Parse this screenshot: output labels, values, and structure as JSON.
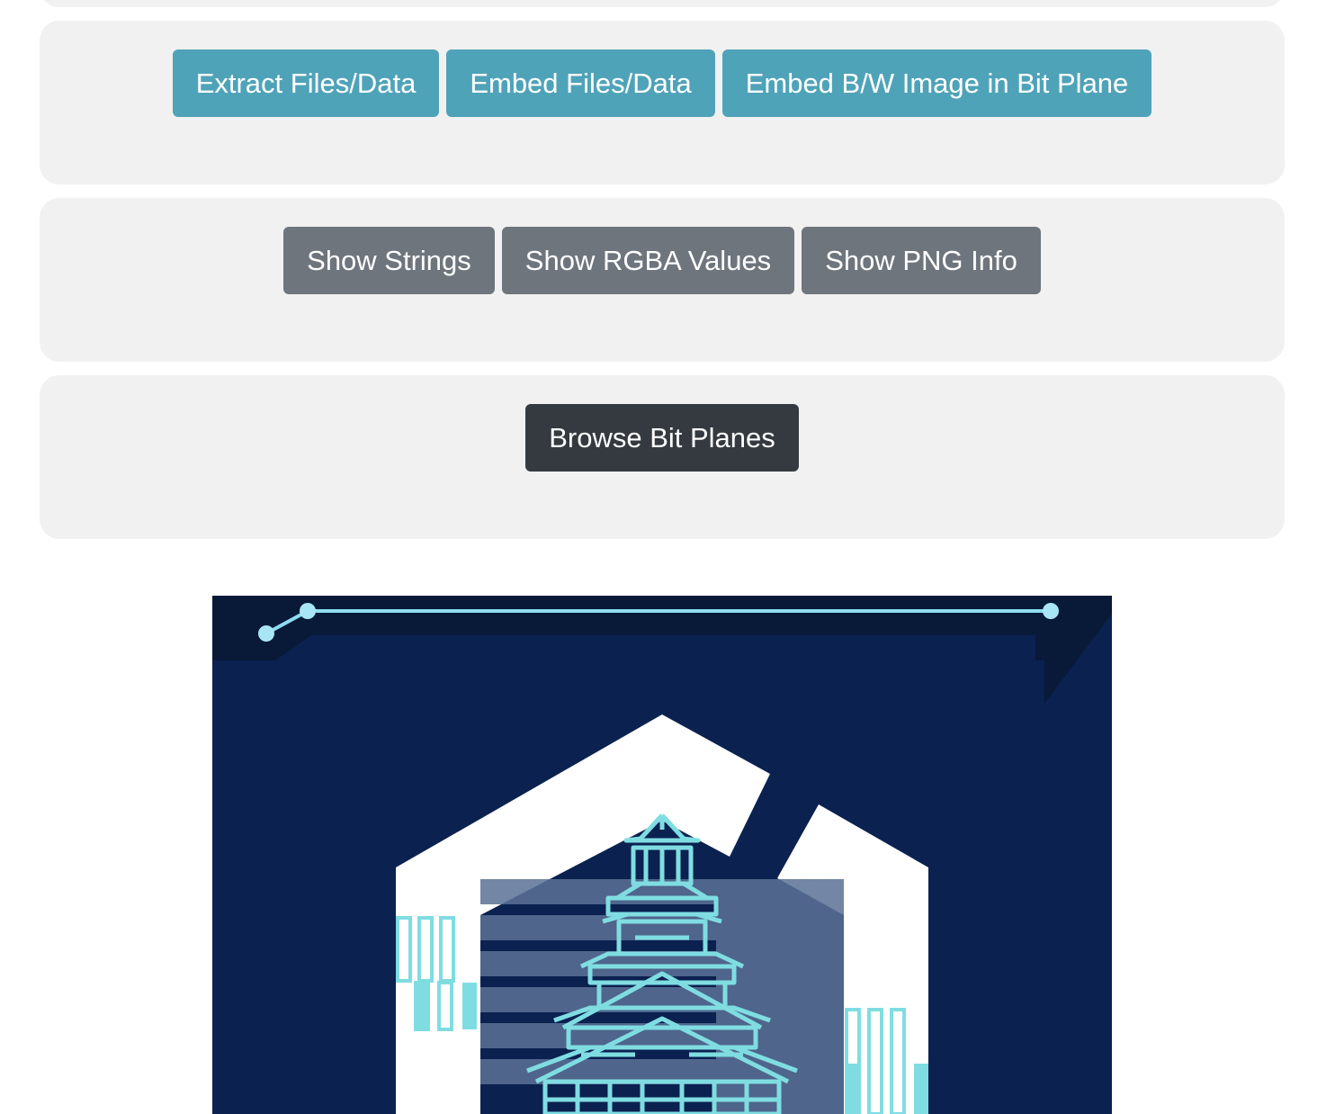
{
  "panels": {
    "embed_extract": {
      "extract_label": "Extract Files/Data",
      "embed_label": "Embed Files/Data",
      "embed_bw_label": "Embed B/W Image in Bit Plane"
    },
    "inspect": {
      "strings_label": "Show Strings",
      "rgba_label": "Show RGBA Values",
      "png_info_label": "Show PNG Info"
    },
    "bit_planes": {
      "browse_label": "Browse Bit Planes"
    }
  },
  "colors": {
    "info_button": "#4fa3b8",
    "secondary_button": "#6e757d",
    "dark_button": "#343a40",
    "panel_bg": "#f1f1f1",
    "image_bg": "#0b2150",
    "image_accent": "#7fdde2"
  },
  "image": {
    "icon": "castle-logo-image"
  }
}
